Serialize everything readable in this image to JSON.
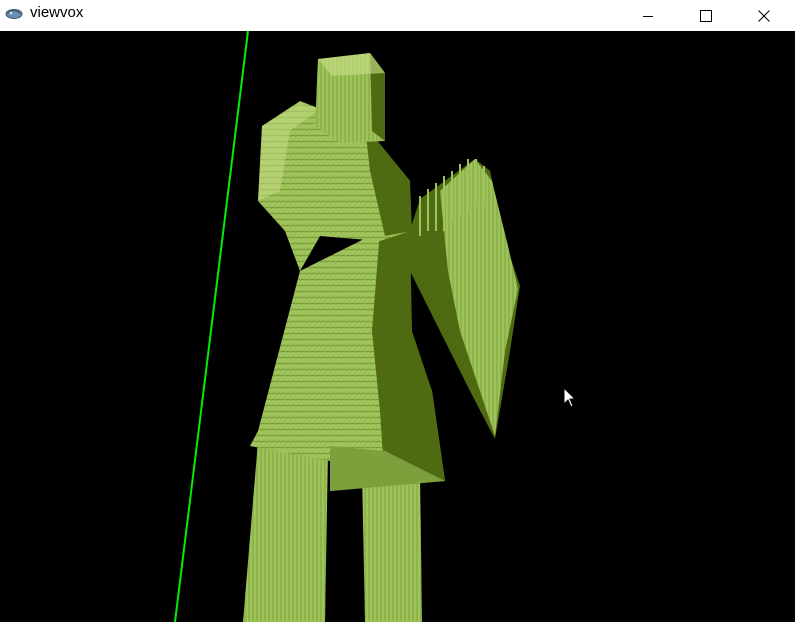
{
  "window": {
    "title": "viewvox",
    "icon": "viewvox-app-icon",
    "controls": {
      "minimize_icon": "minimize-icon",
      "maximize_icon": "maximize-icon",
      "close_icon": "close-icon"
    }
  },
  "viewport": {
    "background": "#000000",
    "axis_color": "#00ee00",
    "model_colors": {
      "lit": "#9ec35a",
      "mid": "#7ea03c",
      "shadow": "#4f6b12",
      "edge": "#c9e08a"
    }
  }
}
